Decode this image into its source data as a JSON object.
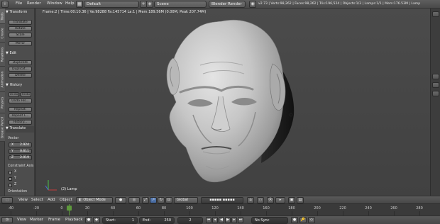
{
  "info_header": {
    "menus": [
      "File",
      "Render",
      "Window",
      "Help"
    ],
    "layout": "Default",
    "scene": "Scene",
    "engine": "Blender Render",
    "stats": "v2.73 | Verts:98,262 | Faces:98,262 | Tris:196,524 | Objects:1/3 | Lamps:1/1 | Mem:176.53M | Lamp"
  },
  "left_tabs": [
    "Tools",
    "Create",
    "Relations",
    "Animation",
    "Physics",
    "Grease Pencil"
  ],
  "tool_shelf": {
    "transform": {
      "title": "Transform",
      "buttons": [
        "Translate",
        "Rotate",
        "Scale",
        "Mirror"
      ]
    },
    "edit": {
      "title": "Edit",
      "buttons": [
        "Duplicate",
        "Duplicat...",
        "Delete"
      ]
    },
    "history": {
      "title": "History",
      "undo": "Undo",
      "redo": "Redo",
      "buttons": [
        "Undo His...",
        "Repeat:",
        "Repeat L...",
        "History..."
      ]
    },
    "operator": {
      "title": "Translate",
      "vector_label": "Vector",
      "vector": [
        {
          "axis": "X",
          "value": "2.924"
        },
        {
          "axis": "Y",
          "value": "0.611"
        },
        {
          "axis": "Z",
          "value": "2.019"
        }
      ],
      "constraint_label": "Constraint Axis",
      "constraint_axes": [
        "X",
        "Y",
        "Z"
      ],
      "orientation_label": "Orientation"
    }
  },
  "viewport": {
    "info": "Frame:2 | Time:00:10.36 | Ve:98288 Fa:145714 La:1 | Mem:189.56M (0.00M, Peak 207.74M)",
    "active_object": "(2) Lamp"
  },
  "view3d_header": {
    "menus": [
      "View",
      "Select",
      "Add",
      "Object"
    ],
    "mode": "Object Mode",
    "orientation": "Global"
  },
  "timeline": {
    "ticks": [
      "-40",
      "-20",
      "0",
      "20",
      "40",
      "60",
      "80",
      "100",
      "120",
      "140",
      "160",
      "180",
      "200",
      "220",
      "240",
      "260",
      "280"
    ],
    "current_frame_marker": "0"
  },
  "timeline_header": {
    "menus": [
      "View",
      "Marker",
      "Frame",
      "Playback"
    ],
    "start": "Start:",
    "start_value": "1",
    "end": "End:",
    "end_value": "250",
    "current": "2",
    "sync": "No Sync"
  },
  "colors": {
    "accent_blue": "#5680c2",
    "mesh_gray": "#c9c9c9"
  }
}
